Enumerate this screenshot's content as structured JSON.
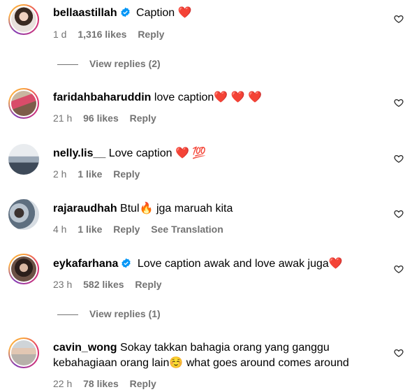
{
  "comments": [
    {
      "username": "bellaastillah",
      "verified": true,
      "text": " Caption ",
      "emoji": "❤️",
      "time": "1 d",
      "likes": "1,316 likes",
      "reply": "Reply",
      "view_replies": "View replies (2)"
    },
    {
      "username": "faridahbaharuddin",
      "verified": false,
      "text": " love caption",
      "emoji": "❤️ ❤️ ❤️",
      "time": "21 h",
      "likes": "96 likes",
      "reply": "Reply"
    },
    {
      "username": "nelly.lis__",
      "verified": false,
      "text": " Love caption ",
      "emoji": "❤️ 💯",
      "time": "2 h",
      "likes": "1 like",
      "reply": "Reply"
    },
    {
      "username": "rajaraudhah",
      "verified": false,
      "text": " Btul",
      "emoji": "🔥",
      "text2": " jga maruah kita",
      "time": "4 h",
      "likes": "1 like",
      "reply": "Reply",
      "see_translation": "See Translation"
    },
    {
      "username": "eykafarhana",
      "verified": true,
      "text": " Love caption awak and love awak juga",
      "emoji": "❤️",
      "time": "23 h",
      "likes": "582 likes",
      "reply": "Reply",
      "view_replies": "View replies (1)"
    },
    {
      "username": "cavin_wong",
      "verified": false,
      "text": " Sokay takkan bahagia orang yang ganggu",
      "text_line2": "kebahagiaan orang lain",
      "emoji": "☺️",
      "text2": " what goes around comes around",
      "time": "22 h",
      "likes": "78 likes",
      "reply": "Reply"
    }
  ],
  "icons": {
    "verified": "verified-badge-icon",
    "like": "heart-outline-icon"
  },
  "colors": {
    "secondary_text": "#737373",
    "verified_blue": "#0095f6",
    "heart_red": "#e0245e"
  }
}
